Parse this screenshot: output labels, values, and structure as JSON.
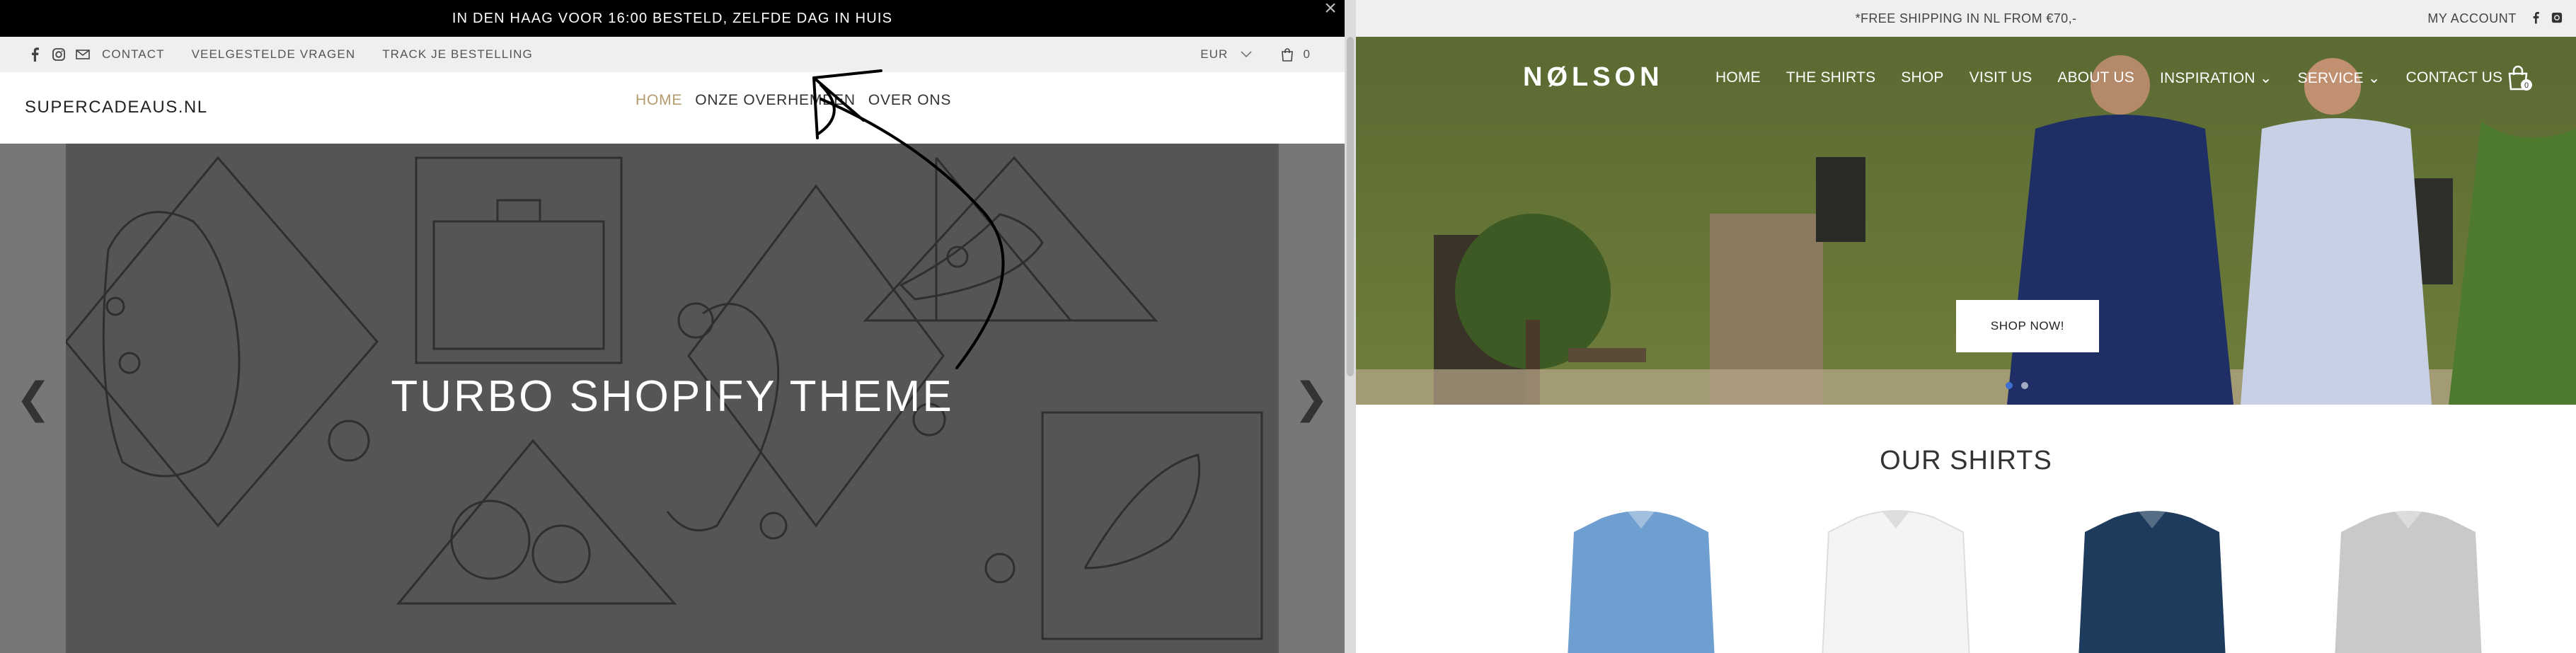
{
  "left": {
    "announcement": "IN DEN HAAG VOOR 16:00 BESTELD, ZELFDE DAG IN HUIS",
    "close_glyph": "×",
    "utility": {
      "links": [
        "CONTACT",
        "VEELGESTELDE VRAGEN",
        "TRACK JE BESTELLING"
      ],
      "currency": "EUR",
      "cart_count": "0"
    },
    "logo": "SUPERCADEAUS.NL",
    "nav": [
      "HOME",
      "ONZE OVERHEMDEN",
      "OVER ONS"
    ],
    "hero_title": "TURBO SHOPIFY THEME",
    "prev_glyph": "❮",
    "next_glyph": "❯"
  },
  "right": {
    "promo": "*FREE SHIPPING IN NL FROM €70,-",
    "account": "MY ACCOUNT",
    "brand": "NØLSON",
    "nav": [
      "HOME",
      "THE SHIRTS",
      "SHOP",
      "VISIT US",
      "ABOUT US",
      "INSPIRATION",
      "SERVICE",
      "CONTACT US"
    ],
    "cart_count": "0",
    "shop_button": "SHOP NOW!",
    "section_title": "OUR SHIRTS",
    "shirt_colors": [
      "#6f9ed0",
      "#f4f4f4",
      "#1d3b5c",
      "#c9c9c9"
    ]
  },
  "colors": {
    "left_accent": "#b39b6e",
    "slider_dot_active": "#3d6fd1"
  }
}
